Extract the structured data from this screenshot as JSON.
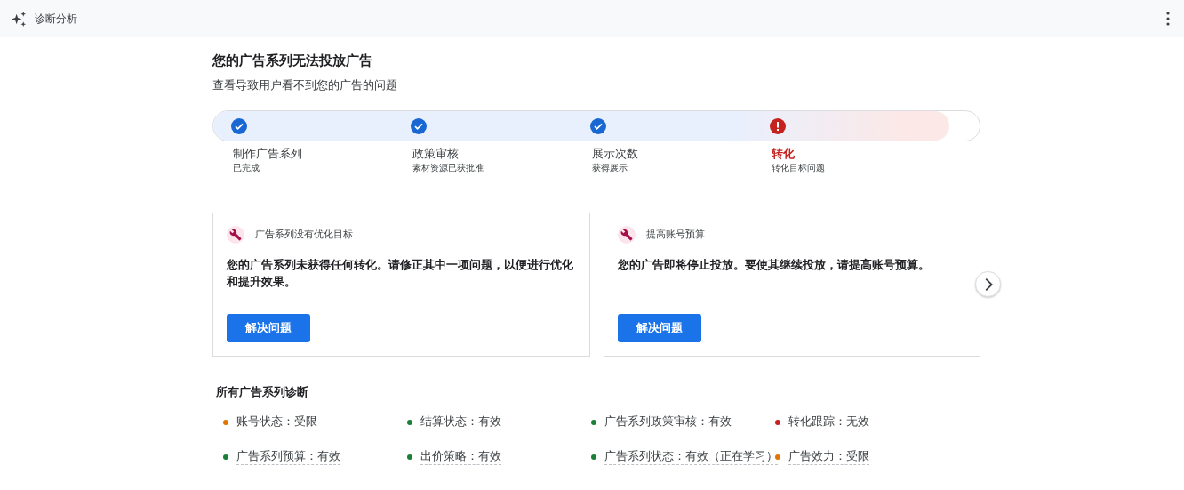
{
  "header": {
    "title": "诊断分析"
  },
  "heading": {
    "title": "您的广告系列无法投放广告",
    "subtitle": "查看导致用户看不到您的广告的问题"
  },
  "steps": [
    {
      "title": "制作广告系列",
      "detail": "已完成",
      "kind": "done"
    },
    {
      "title": "政策审核",
      "detail": "素材资源已获批准",
      "kind": "done"
    },
    {
      "title": "展示次数",
      "detail": "获得展示",
      "kind": "done"
    },
    {
      "title": "转化",
      "detail": "转化目标问题",
      "kind": "error"
    }
  ],
  "cards": [
    {
      "title": "广告系列没有优化目标",
      "message": "您的广告系列未获得任何转化。请修正其中一项问题，以便进行优化和提升效果。",
      "button": "解决问题"
    },
    {
      "title": "提高账号预算",
      "message": "您的广告即将停止投放。要使其继续投放，请提高账号预算。",
      "button": "解决问题"
    }
  ],
  "diagnostics": {
    "title": "所有广告系列诊断",
    "items": [
      {
        "label": "账号状态：受限",
        "color": "#e37400"
      },
      {
        "label": "结算状态：有效",
        "color": "#188038"
      },
      {
        "label": "广告系列政策审核：有效",
        "color": "#188038"
      },
      {
        "label": "转化跟踪：无效",
        "color": "#c5221f"
      },
      {
        "label": "广告系列预算：有效",
        "color": "#188038"
      },
      {
        "label": "出价策略：有效",
        "color": "#188038"
      },
      {
        "label": "广告系列状态：有效（正在学习）",
        "color": "#188038"
      },
      {
        "label": "广告效力：受限",
        "color": "#e37400"
      }
    ]
  }
}
